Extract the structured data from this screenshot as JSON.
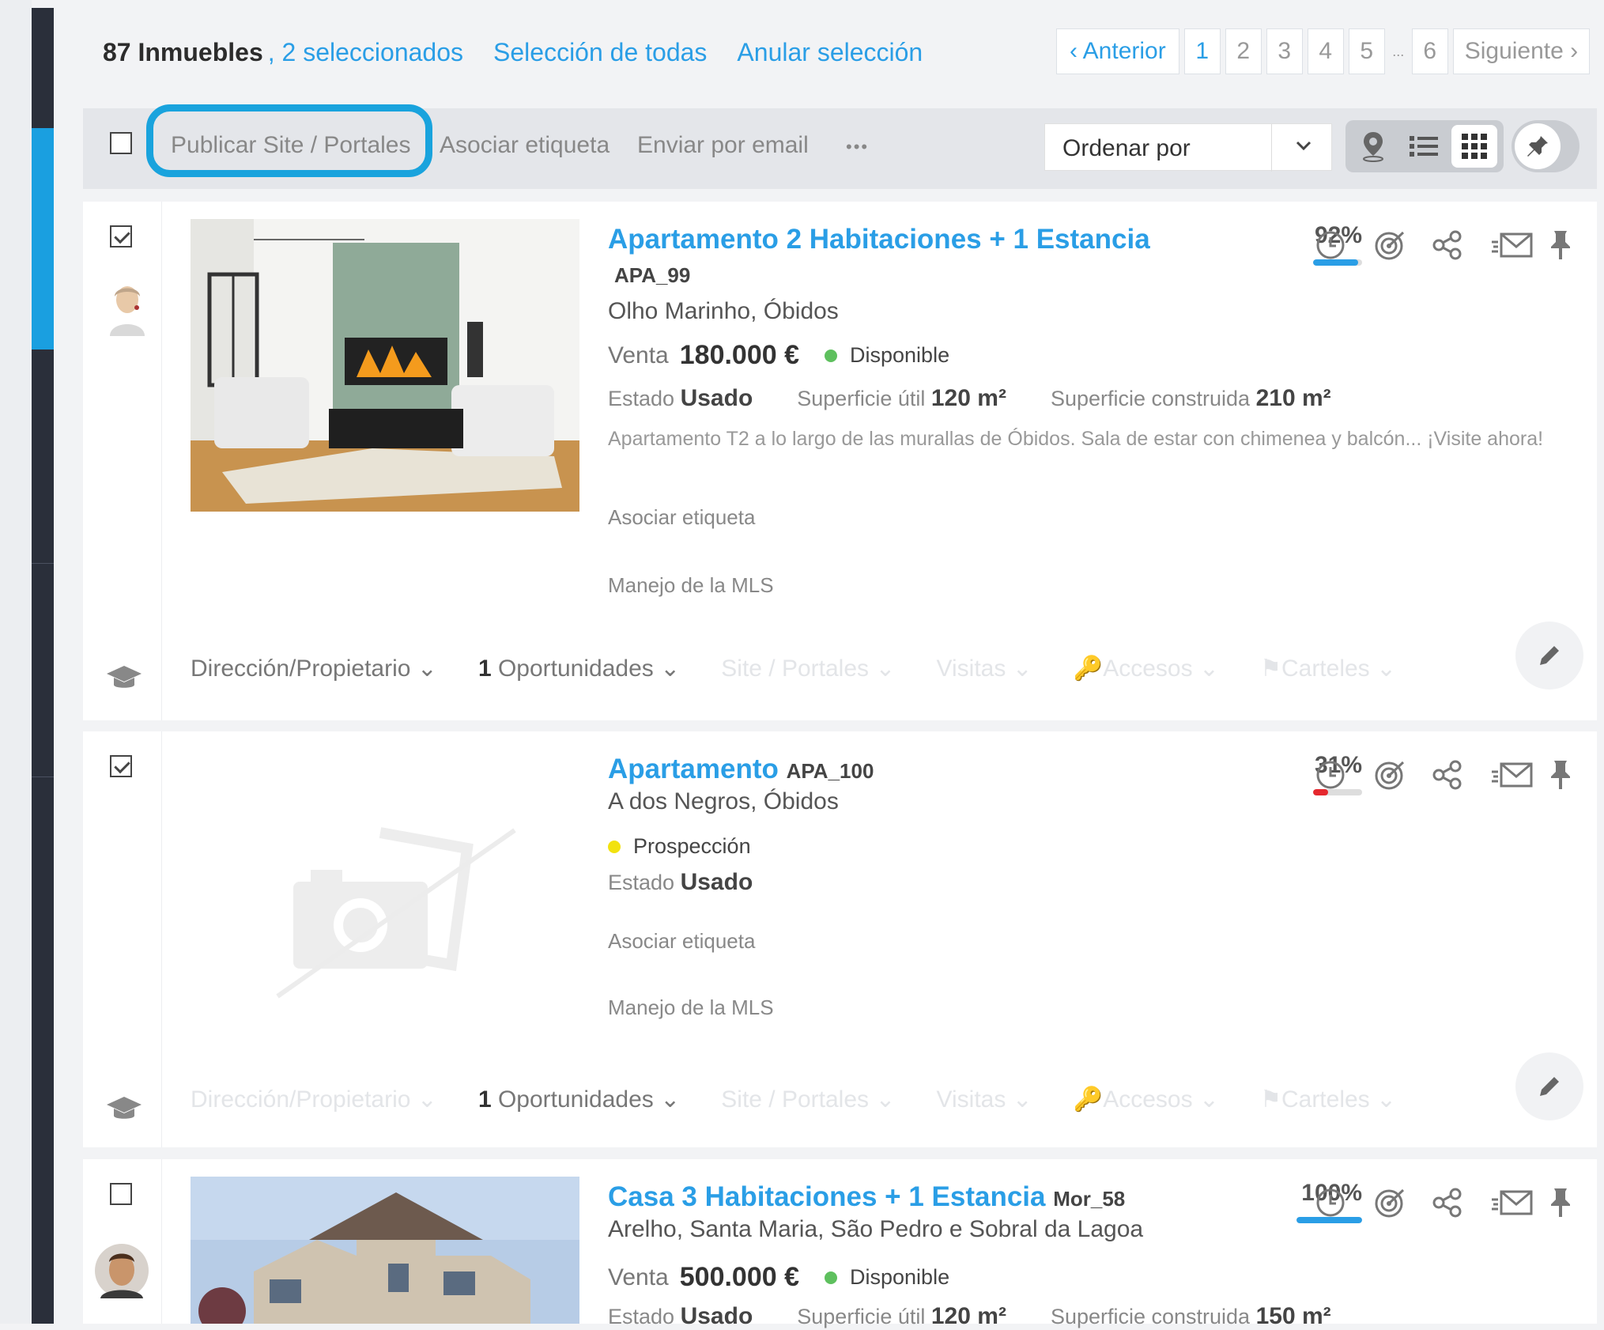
{
  "header": {
    "count": "87 Inmuebles",
    "selected": ", 2 seleccionados",
    "select_all": "Selección de todas",
    "clear_selection": "Anular selección"
  },
  "pagination": {
    "prev": "‹ Anterior",
    "pages": [
      "1",
      "2",
      "3",
      "4",
      "5"
    ],
    "ellipsis": "...",
    "last": "6",
    "next": "Siguiente ›",
    "current": "1"
  },
  "toolbar": {
    "publish": "Publicar Site / Portales",
    "tag": "Asociar etiqueta",
    "email": "Enviar por email",
    "more": "•••",
    "sort_label": "Ordenar por"
  },
  "icons": [
    "select-all-checkbox",
    "map-pin-icon",
    "list-view-icon",
    "grid-view-icon",
    "pin-icon",
    "history-icon",
    "target-icon",
    "share-icon",
    "email-icon",
    "pin-icon",
    "edit-icon",
    "graduation-cap-icon",
    "chevron-down-icon",
    "key-icon",
    "flag-icon"
  ],
  "colors": {
    "accent": "#2a9ee6",
    "highlight": "#19a3dd",
    "available": "#5ec05e",
    "prospect": "#f2e20f",
    "low": "#e5282e",
    "sidebar": "#2a2f3a"
  },
  "properties": [
    {
      "title": "Apartamento 2 Habitaciones + 1 Estancia",
      "ref": "APA_99",
      "location": "Olho Marinho, Óbidos",
      "operation": "Venta",
      "price": "180.000 €",
      "status": "Disponible",
      "estado_label": "Estado",
      "estado": "Usado",
      "sup_util_label": "Superficie útil",
      "sup_util": "120 m²",
      "sup_cons_label": "Superficie construida",
      "sup_cons": "210 m²",
      "description": "Apartamento T2 a lo largo de las murallas de Óbidos. Sala de estar con chimenea y balcón... ¡Visite ahora!",
      "tag": "Asociar etiqueta",
      "mls": "Manejo de la MLS",
      "percent": "92%",
      "percent_value": 92,
      "checked": true,
      "footer": {
        "owner": "Dirección/Propietario",
        "opp_count": "1",
        "opp": "Oportunidades",
        "site": "Site / Portales",
        "visits": "Visitas",
        "access": "Accesos",
        "signs": "Carteles"
      }
    },
    {
      "title": "Apartamento",
      "ref": "APA_100",
      "location": "A dos Negros, Óbidos",
      "status": "Prospección",
      "estado_label": "Estado",
      "estado": "Usado",
      "tag": "Asociar etiqueta",
      "mls": "Manejo de la MLS",
      "percent": "31%",
      "percent_value": 31,
      "checked": true,
      "footer": {
        "owner": "Dirección/Propietario",
        "opp_count": "1",
        "opp": "Oportunidades",
        "site": "Site / Portales",
        "visits": "Visitas",
        "access": "Accesos",
        "signs": "Carteles"
      }
    },
    {
      "title": "Casa 3 Habitaciones + 1 Estancia",
      "ref": "Mor_58",
      "location": "Arelho, Santa Maria, São Pedro e Sobral da Lagoa",
      "operation": "Venta",
      "price": "500.000 €",
      "status": "Disponible",
      "estado_label": "Estado",
      "estado": "Usado",
      "sup_util_label": "Superficie útil",
      "sup_util": "120 m²",
      "sup_cons_label": "Superficie construida",
      "sup_cons": "150 m²",
      "percent": "100%",
      "percent_value": 100,
      "checked": false
    }
  ]
}
